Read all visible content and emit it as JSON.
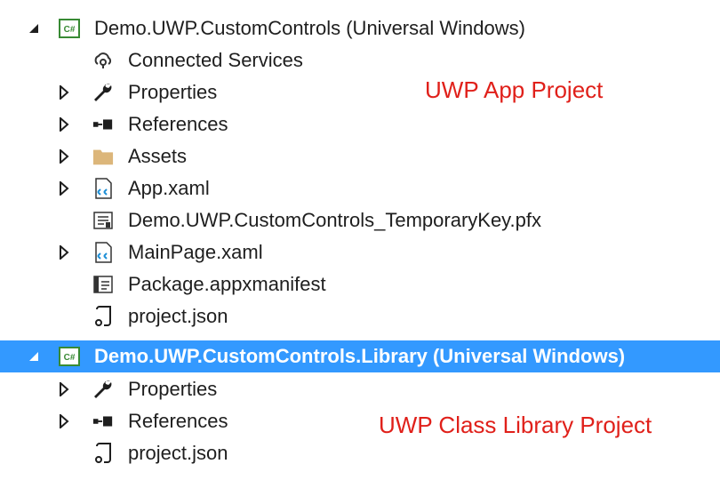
{
  "tree": {
    "nodes": [
      {
        "label": "Demo.UWP.CustomControls (Universal Windows)",
        "icon": "csharp-project-icon",
        "expander": "expanded"
      },
      {
        "label": "Connected Services",
        "icon": "connected-services-icon",
        "expander": "none"
      },
      {
        "label": "Properties",
        "icon": "wrench-icon",
        "expander": "collapsed"
      },
      {
        "label": "References",
        "icon": "references-icon",
        "expander": "collapsed"
      },
      {
        "label": "Assets",
        "icon": "folder-icon",
        "expander": "collapsed"
      },
      {
        "label": "App.xaml",
        "icon": "xaml-file-icon",
        "expander": "collapsed"
      },
      {
        "label": "Demo.UWP.CustomControls_TemporaryKey.pfx",
        "icon": "certificate-icon",
        "expander": "none"
      },
      {
        "label": "MainPage.xaml",
        "icon": "xaml-file-icon",
        "expander": "collapsed"
      },
      {
        "label": "Package.appxmanifest",
        "icon": "manifest-icon",
        "expander": "none"
      },
      {
        "label": "project.json",
        "icon": "json-file-icon",
        "expander": "none"
      },
      {
        "label": "Demo.UWP.CustomControls.Library (Universal Windows)",
        "icon": "csharp-project-icon",
        "expander": "expanded",
        "selected": true
      },
      {
        "label": "Properties",
        "icon": "wrench-icon",
        "expander": "collapsed"
      },
      {
        "label": "References",
        "icon": "references-icon",
        "expander": "collapsed"
      },
      {
        "label": "project.json",
        "icon": "json-file-icon",
        "expander": "none"
      }
    ]
  },
  "annotations": {
    "app_project": "UWP App Project",
    "library_project": "UWP Class Library Project"
  },
  "colors": {
    "selection": "#3399ff",
    "annotation": "#e0201a",
    "folder": "#dcb67a",
    "csharp_badge": "#388a34"
  }
}
